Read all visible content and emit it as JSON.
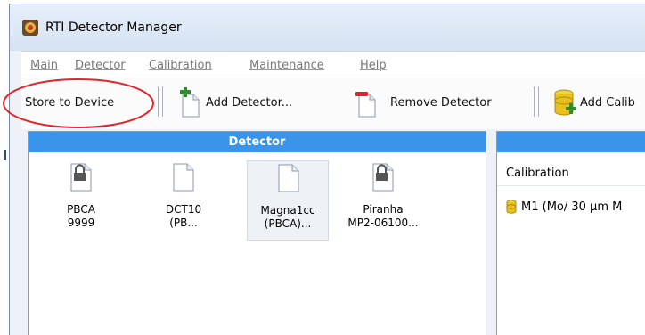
{
  "window": {
    "title": "RTI Detector Manager"
  },
  "menu": [
    "Main",
    "Detector",
    "Calibration",
    "Maintenance",
    "Help"
  ],
  "toolbar": {
    "store_label": "Store to Device",
    "add_detector_label": "Add Detector...",
    "remove_detector_label": "Remove Detector",
    "add_calibration_label": "Add Calib"
  },
  "detector_panel": {
    "header": "Detector",
    "items": [
      {
        "line1": "PBCA",
        "line2": "9999",
        "locked": true
      },
      {
        "line1": "DCT10",
        "line2": "(PB...",
        "locked": false
      },
      {
        "line1": "Magna1cc",
        "line2": "(PBCA)...",
        "locked": false
      },
      {
        "line1": "Piranha",
        "line2": "MP2-06100...",
        "locked": true
      }
    ]
  },
  "calibration_panel": {
    "header": "",
    "column_header": "Calibration",
    "rows": [
      {
        "text": "M1  (Mo/ 30 µm M"
      }
    ]
  },
  "colors": {
    "panel_header": "#3a94ea",
    "highlight": "#e0262a"
  }
}
